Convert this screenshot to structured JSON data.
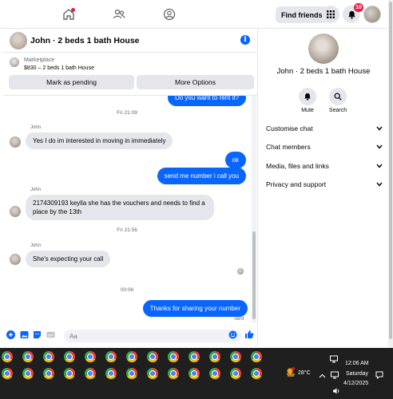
{
  "nav": {
    "find_friends": "Find friends",
    "notif_count": "10"
  },
  "chat": {
    "title": "John · 2 beds 1 bath House"
  },
  "marketplace": {
    "label": "Marketplace",
    "listing": "$830 – 2 beds 1 bath House",
    "mark_pending": "Mark as pending",
    "more_options": "More Options"
  },
  "messages": {
    "partial_out": "Do you want to rent it?",
    "time1": "Fri 21:09",
    "sender": "John",
    "in1": "Yes I do im interested in moving in immediately",
    "out1": "ok",
    "out2": "send me number i call you",
    "in2": "2174309193 keylla she has the vouchers and needs to find a place by the 13th",
    "time2": "Fri 21:56",
    "in3": "She's expecting your call",
    "time3": "00:06",
    "out3": "Thanks for sharing your number",
    "sent": "Sent"
  },
  "composer": {
    "placeholder": "Aa"
  },
  "right_panel": {
    "title": "John · 2 beds 1 bath House",
    "mute": "Mute",
    "search": "Search",
    "rows": [
      "Customise chat",
      "Chat members",
      "Media, files and links",
      "Privacy and support"
    ]
  },
  "taskbar": {
    "temperature": "28°C",
    "time": "12:06 AM",
    "day": "Saturday",
    "date": "4/12/2025"
  },
  "colors": {
    "accent": "#0866ff",
    "bubble_in": "#e4e6eb",
    "badge": "#e41e3f",
    "taskbar": "#1f1f1f"
  }
}
